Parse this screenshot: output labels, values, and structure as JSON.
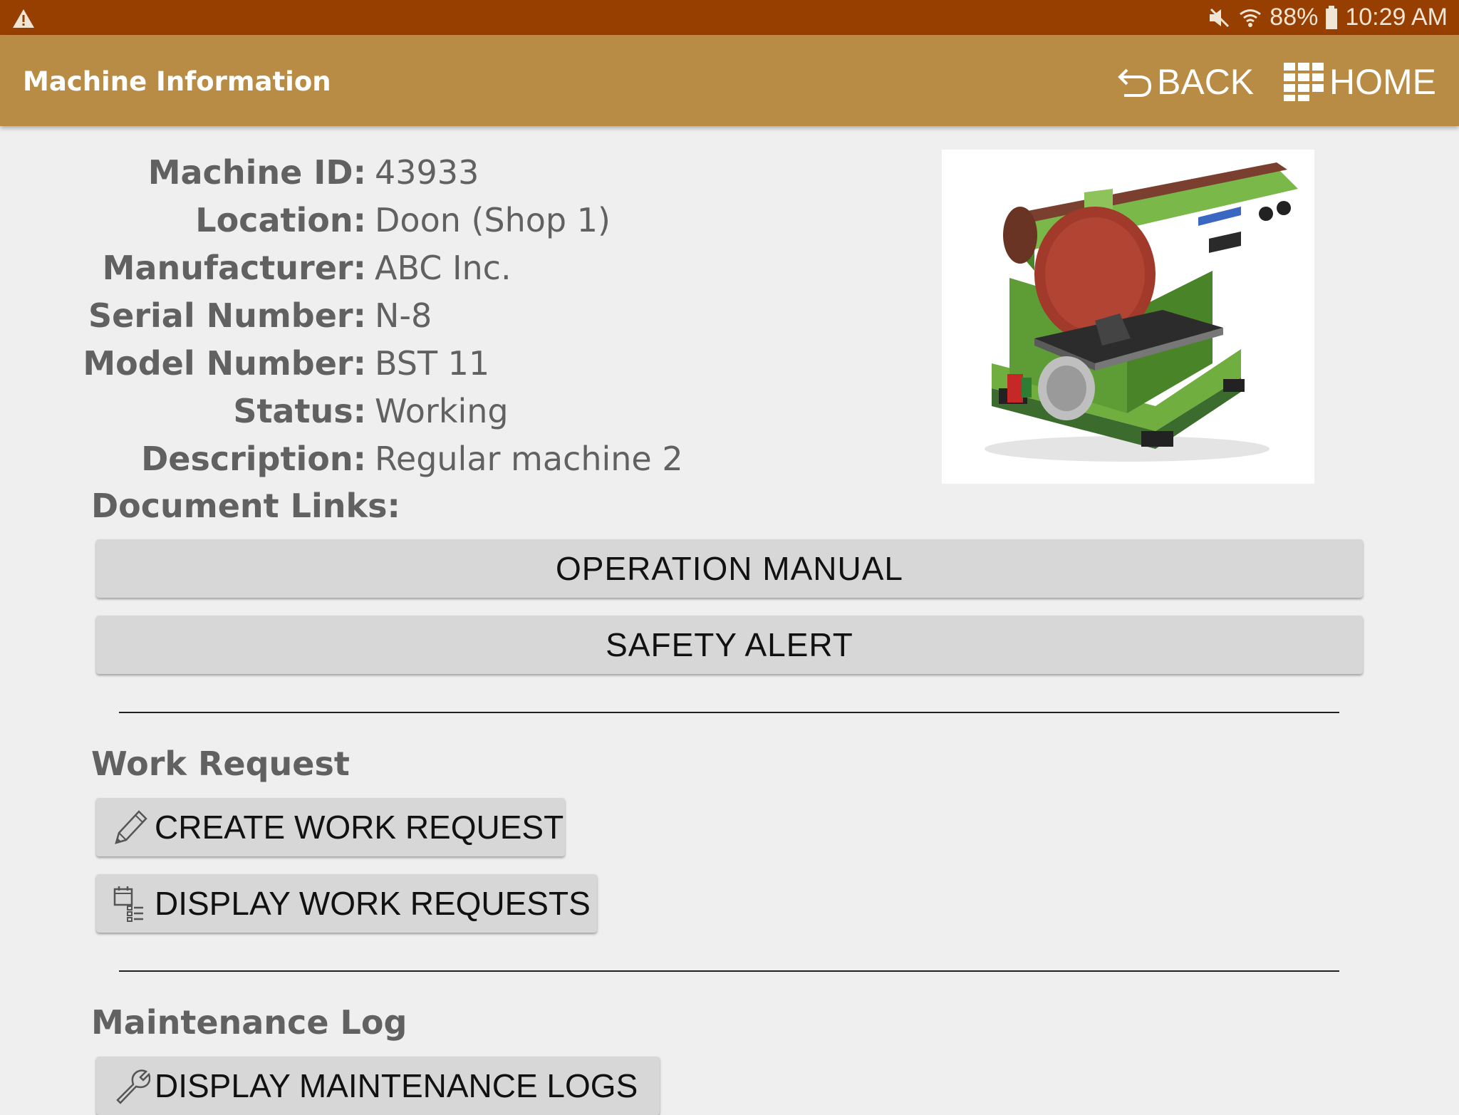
{
  "status_bar": {
    "battery": "88%",
    "time": "10:29 AM",
    "icons": [
      "warning-icon",
      "mute-icon",
      "wifi-icon",
      "battery-icon"
    ]
  },
  "app_bar": {
    "title": "Machine Information",
    "back_label": "BACK",
    "home_label": "HOME"
  },
  "machine": {
    "id_label": "Machine ID:",
    "id": "43933",
    "location_label": "Location:",
    "location": "Doon (Shop 1)",
    "manufacturer_label": "Manufacturer:",
    "manufacturer": "ABC Inc.",
    "serial_label": "Serial Number:",
    "serial": "N-8",
    "model_label": "Model Number:",
    "model": "BST 11",
    "status_label": "Status:",
    "status": "Working",
    "description_label": "Description:",
    "description": "Regular machine 2"
  },
  "documents": {
    "heading": "Document Links:",
    "operation_manual": "OPERATION MANUAL",
    "safety_alert": "SAFETY ALERT"
  },
  "work_request": {
    "heading": "Work Request",
    "create_label": "CREATE WORK REQUEST",
    "display_label": "DISPLAY WORK REQUESTS"
  },
  "maintenance": {
    "heading": "Maintenance Log",
    "display_label": "DISPLAY MAINTENANCE LOGS"
  },
  "colors": {
    "status_bar": "#963f00",
    "app_bar": "#b98c46",
    "background": "#efefef",
    "button": "#d7d7d7"
  }
}
